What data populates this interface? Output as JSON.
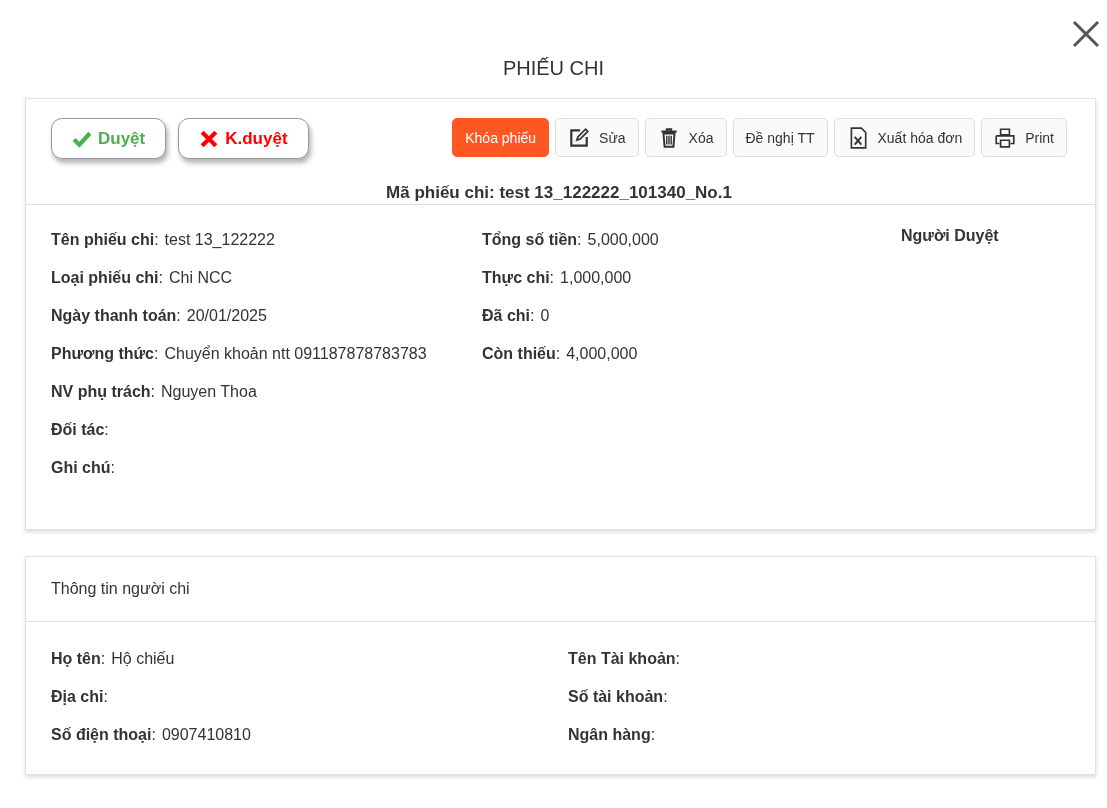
{
  "title": "PHIẾU CHI",
  "approval_buttons": [
    {
      "kind": "approve",
      "label": "Duyệt"
    },
    {
      "kind": "reject",
      "label": "K.duyệt"
    }
  ],
  "toolbar": [
    {
      "kind": "primary",
      "label": "Khóa phiếu"
    },
    {
      "kind": "edit",
      "label": "Sửa"
    },
    {
      "kind": "delete",
      "label": "Xóa"
    },
    {
      "kind": "plain",
      "label": "Đề nghị TT"
    },
    {
      "kind": "excel",
      "label": "Xuất hóa đơn"
    },
    {
      "kind": "print",
      "label": "Print"
    }
  ],
  "voucher_code": "Mã phiếu chi: test 13_122222_101340_No.1",
  "details": {
    "column_1": [
      {
        "label": "**Tên phiếu chi**:",
        "value": "test 13_122222"
      },
      {
        "label": "**Loại phiếu chi**:",
        "value": "Chi NCC"
      },
      {
        "label": "**Ngày thanh toán**:",
        "value": "20/01/2025"
      },
      {
        "label": "**Phương thức**:",
        "value": "Chuyển khoản ntt 091187878783783"
      },
      {
        "label": "**NV phụ trách**:",
        "value": "Nguyen Thoa"
      },
      {
        "label": "**Đối tác**:"
      },
      {
        "label": "**Ghi chú**:"
      }
    ],
    "column_2": [
      {
        "label": "**Tổng số tiền**:",
        "value": "5,000,000"
      },
      {
        "label": "**Thực chi**:",
        "value": "1,000,000"
      },
      {
        "label": "**Đã chi**:",
        "value": "0"
      },
      {
        "label": "**Còn thiếu**:",
        "value": "4,000,000"
      }
    ],
    "approver_heading": "Người Duyệt"
  },
  "payer": {
    "heading": "Thông tin người chi",
    "column_1": [
      {
        "label": "**Họ tên**:",
        "value": "Hộ chiếu"
      },
      {
        "label": "**Địa chỉ**:"
      },
      {
        "label": "**Số điện thoại**:",
        "value": "0907410810"
      }
    ],
    "column_2": [
      {
        "label": "**Tên Tài khoản**:"
      },
      {
        "label": "**Số tài khoản**:"
      },
      {
        "label": "**Ngân hàng**:"
      }
    ]
  }
}
